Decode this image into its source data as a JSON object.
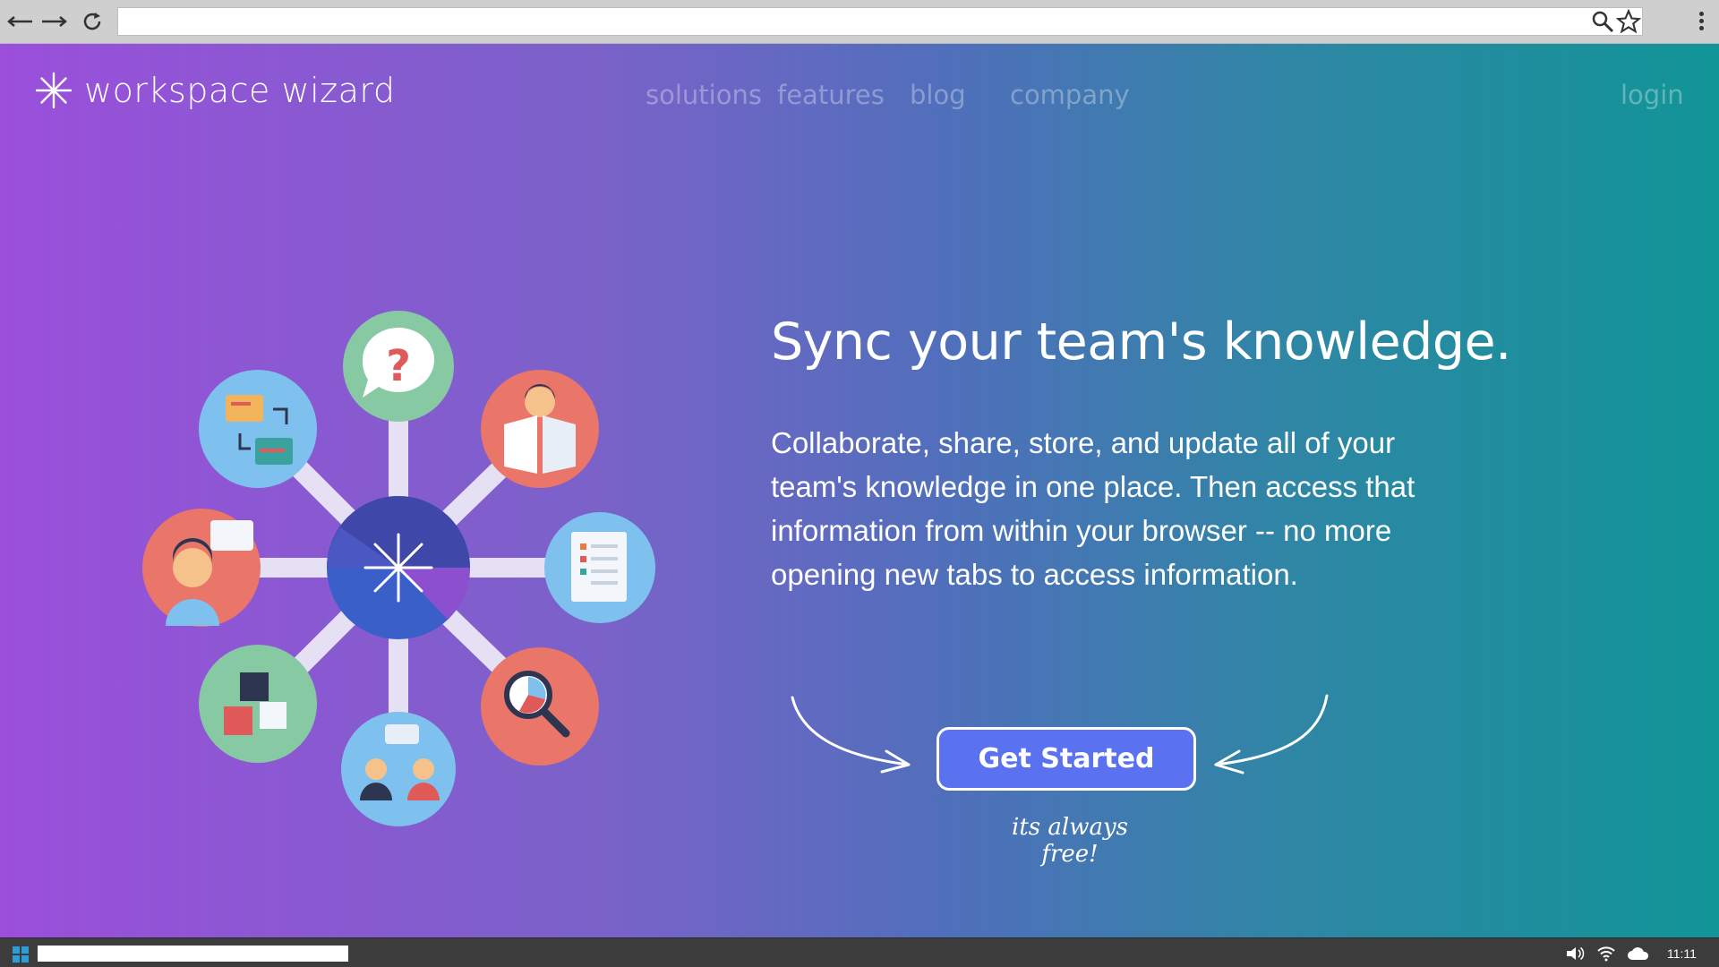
{
  "browser": {
    "url": "",
    "back_icon": "arrow-left-icon",
    "forward_icon": "arrow-right-icon",
    "reload_icon": "reload-icon",
    "search_icon": "magnifier-icon",
    "bookmark_icon": "star-icon",
    "menu_icon": "kebab-menu-icon"
  },
  "site": {
    "logo_text": "workspace wizard",
    "nav": {
      "solutions": "solutions",
      "features": "features",
      "blog": "blog",
      "company": "company",
      "login": "login"
    }
  },
  "hero": {
    "headline": "Sync your team's knowledge.",
    "subtext": "Collaborate, share, store, and update all of your team's knowledge in one place. Then access that information from within your browser -- no more opening new tabs to access information.",
    "cta_label": "Get Started",
    "note": "its always free!"
  },
  "taskbar": {
    "time": "11:11",
    "start_icon": "windows-start-icon",
    "tray_icons": [
      "volume-icon",
      "wifi-icon",
      "cloud-icon"
    ]
  },
  "colors": {
    "gradient_left": "#9b4fdb",
    "gradient_right": "#119597",
    "cta_fill": "#5b72f0",
    "taskbar": "#3c3c3c",
    "chrome": "#cfcfcf"
  }
}
